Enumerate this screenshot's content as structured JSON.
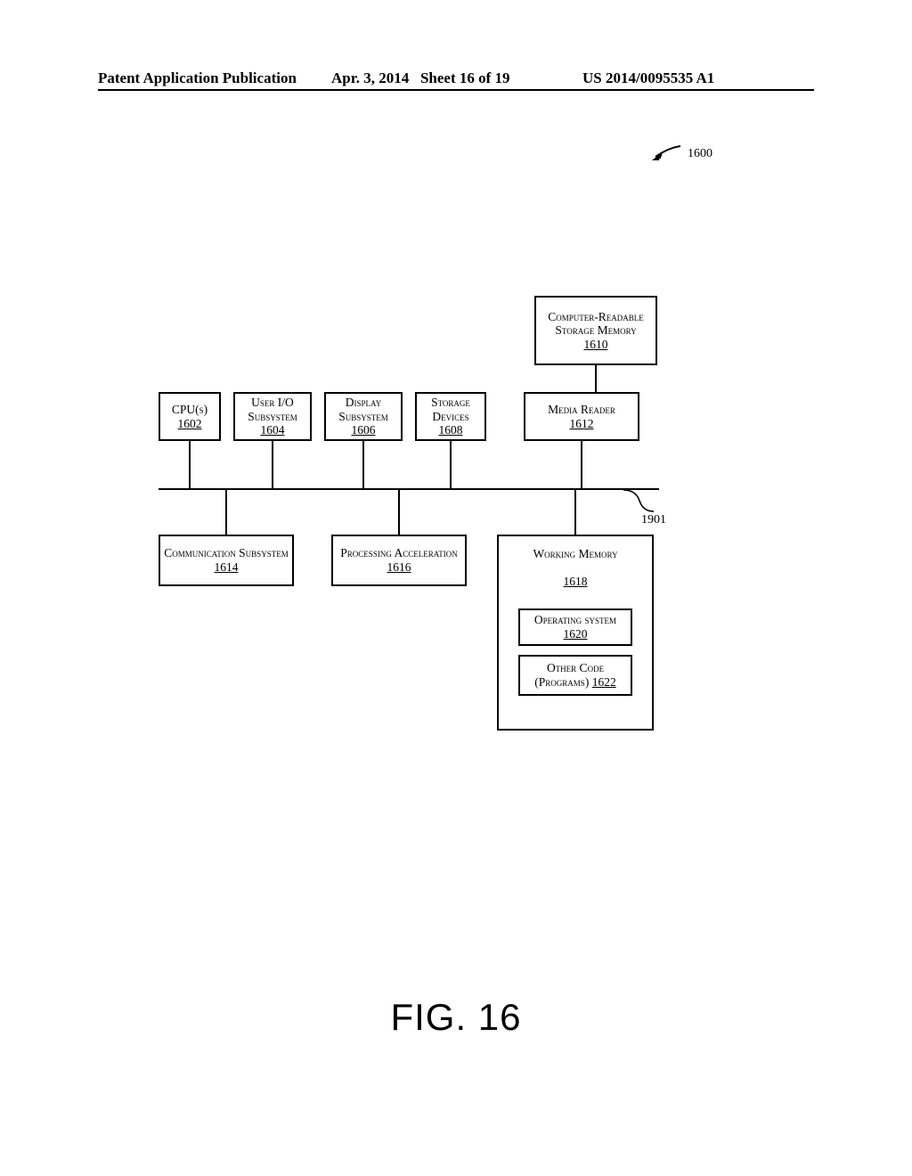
{
  "header": {
    "left": "Patent Application Publication",
    "date": "Apr. 3, 2014",
    "sheet": "Sheet 16 of 19",
    "pubno": "US 2014/0095535 A1"
  },
  "diagram": {
    "ref_main": "1600",
    "bus_ref": "1901",
    "boxes": {
      "b1610": {
        "label": "Computer-Readable Storage Memory",
        "ref": "1610"
      },
      "b1602": {
        "label": "CPU(s)",
        "ref": "1602"
      },
      "b1604": {
        "label": "User I/O Subsystem",
        "ref": "1604"
      },
      "b1606": {
        "label": "Display Subsystem",
        "ref": "1606"
      },
      "b1608": {
        "label": "Storage Devices",
        "ref": "1608"
      },
      "b1612": {
        "label": "Media Reader",
        "ref": "1612"
      },
      "b1614": {
        "label_pre": "Communication Subsystem",
        "ref": "1614"
      },
      "b1616": {
        "label_pre": "Processing Acceleration",
        "ref": "1616"
      },
      "b1618": {
        "label": "Working Memory",
        "ref": "1618"
      },
      "b1620": {
        "label_pre": "Operating system",
        "ref": "1620"
      },
      "b1622": {
        "label_pre": "Other Code (Programs)",
        "ref": "1622"
      }
    }
  },
  "caption": "FIG. 16"
}
